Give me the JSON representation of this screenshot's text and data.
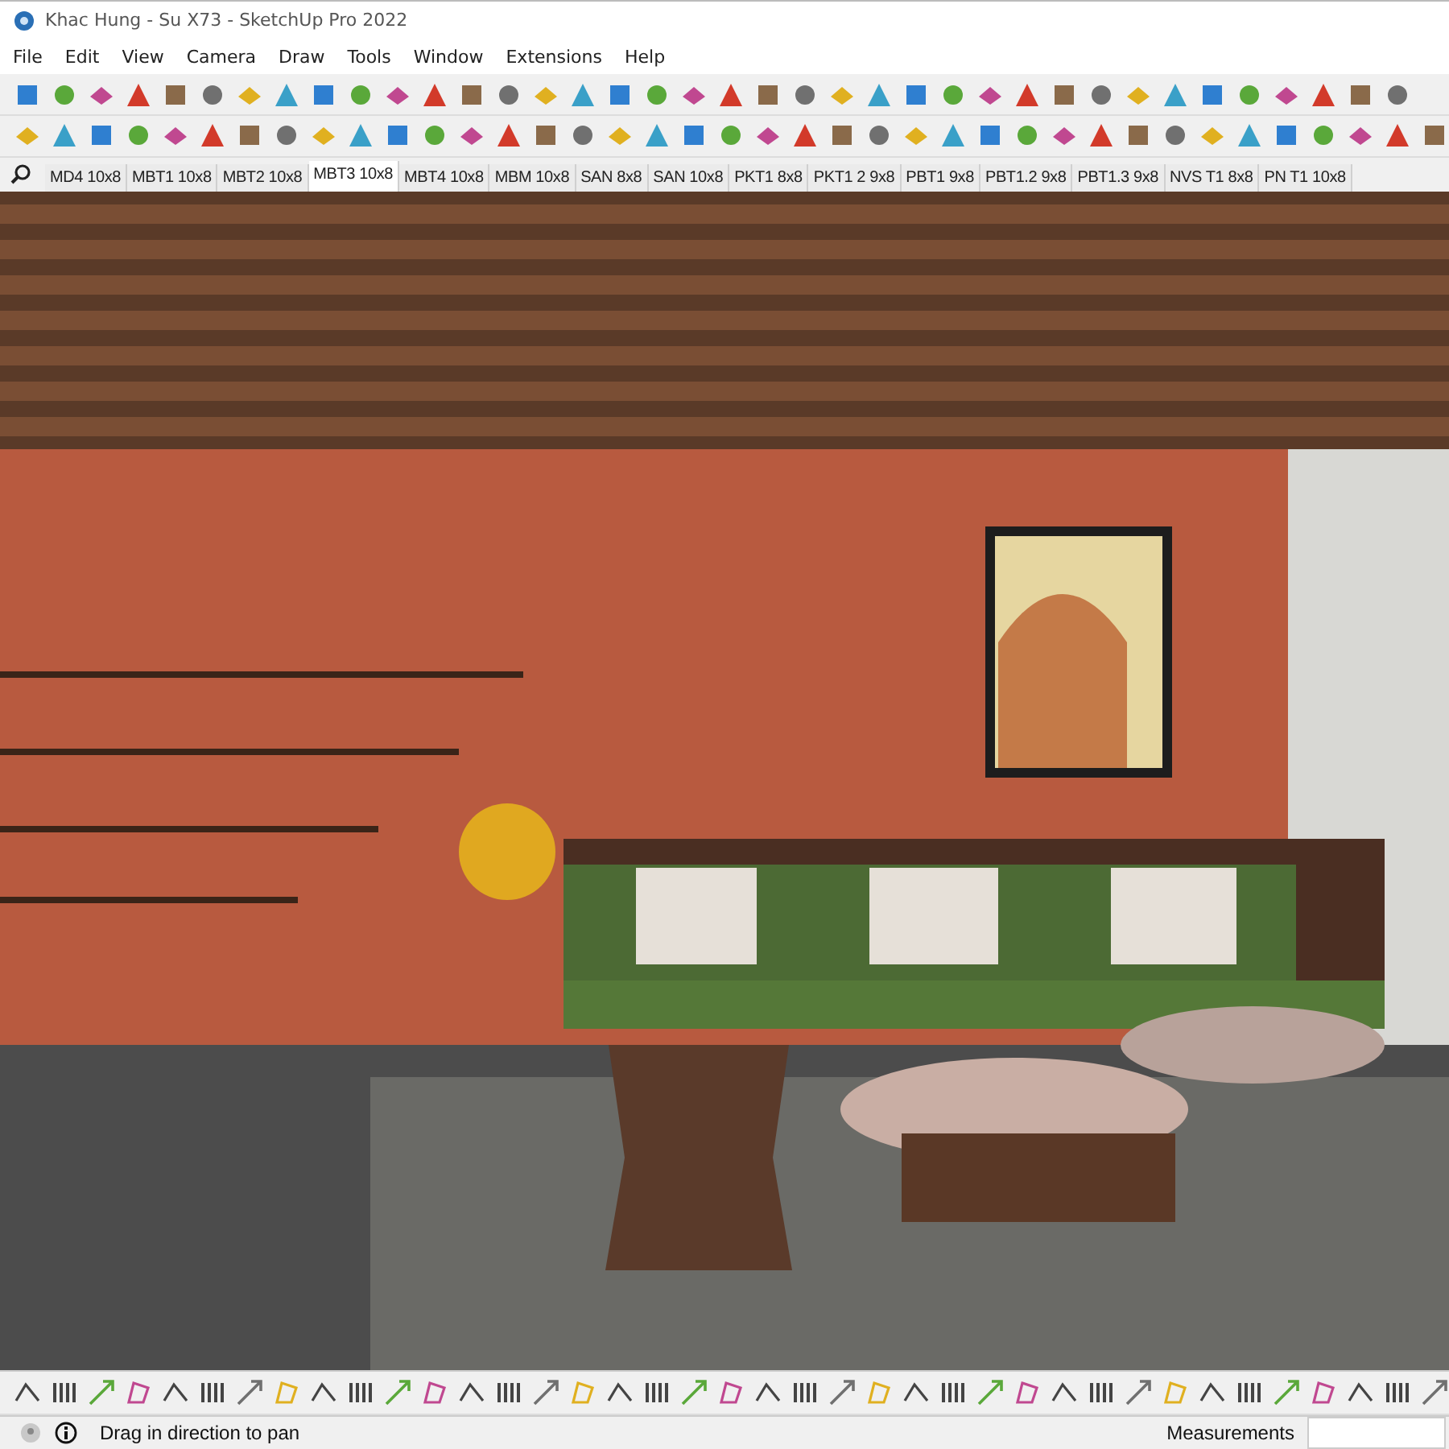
{
  "window": {
    "title": "Khac Hung - Su X73 - SketchUp Pro 2022"
  },
  "menu": [
    "File",
    "Edit",
    "View",
    "Camera",
    "Draw",
    "Tools",
    "Window",
    "Extensions",
    "Help"
  ],
  "scenes": [
    {
      "label": "MD4 10x8",
      "selected": false
    },
    {
      "label": "MBT1 10x8",
      "selected": false
    },
    {
      "label": "MBT2 10x8",
      "selected": false
    },
    {
      "label": "MBT3 10x8",
      "selected": true
    },
    {
      "label": "MBT4 10x8",
      "selected": false
    },
    {
      "label": "MBM 10x8",
      "selected": false
    },
    {
      "label": "SAN 8x8",
      "selected": false
    },
    {
      "label": "SAN 10x8",
      "selected": false
    },
    {
      "label": "PKT1 8x8",
      "selected": false
    },
    {
      "label": "PKT1 2 9x8",
      "selected": false
    },
    {
      "label": "PBT1 9x8",
      "selected": false
    },
    {
      "label": "PBT1.2 9x8",
      "selected": false
    },
    {
      "label": "PBT1.3 9x8",
      "selected": false
    },
    {
      "label": "NVS T1 8x8",
      "selected": false
    },
    {
      "label": "PN T1 10x8",
      "selected": false
    }
  ],
  "status_bar": {
    "hint": "Drag in direction to pan",
    "measurements_label": "Measurements"
  }
}
